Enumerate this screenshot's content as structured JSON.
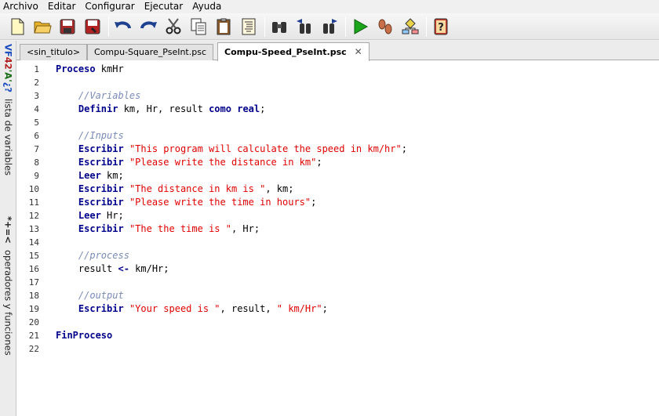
{
  "menu": [
    "Archivo",
    "Editar",
    "Configurar",
    "Ejecutar",
    "Ayuda"
  ],
  "toolbar": {
    "buttons": [
      {
        "name": "new-file-icon"
      },
      {
        "name": "open-folder-icon"
      },
      {
        "name": "save-icon"
      },
      {
        "name": "save-as-icon"
      },
      {
        "name": "undo-icon"
      },
      {
        "name": "redo-icon"
      },
      {
        "name": "cut-icon"
      },
      {
        "name": "copy-icon"
      },
      {
        "name": "paste-icon"
      },
      {
        "name": "indent-icon"
      },
      {
        "name": "find-icon"
      },
      {
        "name": "find-previous-icon"
      },
      {
        "name": "find-next-icon"
      },
      {
        "name": "run-icon"
      },
      {
        "name": "step-by-step-icon"
      },
      {
        "name": "flowchart-icon"
      },
      {
        "name": "help-icon"
      }
    ]
  },
  "side_tabs": {
    "variables": {
      "icon_parts": [
        "V",
        "F",
        "42",
        "'A'",
        "¿?"
      ],
      "label": "lista de variables"
    },
    "operators": {
      "icon": "*+=<",
      "label": "operadores y funciones"
    }
  },
  "tabs": [
    {
      "label": "<sin_titulo>",
      "active": false
    },
    {
      "label": "Compu-Square_PseInt.psc",
      "active": false
    },
    {
      "label": "Compu-Speed_PseInt.psc",
      "active": true,
      "close": "✕"
    }
  ],
  "editor": {
    "lines": [
      {
        "n": "1",
        "tokens": [
          {
            "t": "Proceso",
            "k": "kw"
          },
          {
            "t": " kmHr",
            "k": "plain"
          }
        ]
      },
      {
        "n": "2",
        "tokens": []
      },
      {
        "n": "3",
        "tokens": [
          {
            "t": "    //Variables",
            "k": "cmt"
          }
        ]
      },
      {
        "n": "4",
        "tokens": [
          {
            "t": "    ",
            "k": "plain"
          },
          {
            "t": "Definir",
            "k": "kw"
          },
          {
            "t": " km, Hr, result ",
            "k": "plain"
          },
          {
            "t": "como",
            "k": "kw"
          },
          {
            "t": " ",
            "k": "plain"
          },
          {
            "t": "real",
            "k": "kw"
          },
          {
            "t": ";",
            "k": "plain"
          }
        ]
      },
      {
        "n": "5",
        "tokens": []
      },
      {
        "n": "6",
        "tokens": [
          {
            "t": "    //Inputs",
            "k": "cmt"
          }
        ]
      },
      {
        "n": "7",
        "tokens": [
          {
            "t": "    ",
            "k": "plain"
          },
          {
            "t": "Escribir",
            "k": "kw"
          },
          {
            "t": " ",
            "k": "plain"
          },
          {
            "t": "\"This program will calculate the speed in km/hr\"",
            "k": "str"
          },
          {
            "t": ";",
            "k": "plain"
          }
        ]
      },
      {
        "n": "8",
        "tokens": [
          {
            "t": "    ",
            "k": "plain"
          },
          {
            "t": "Escribir",
            "k": "kw"
          },
          {
            "t": " ",
            "k": "plain"
          },
          {
            "t": "\"Please write the distance in km\"",
            "k": "str"
          },
          {
            "t": ";",
            "k": "plain"
          }
        ]
      },
      {
        "n": "9",
        "tokens": [
          {
            "t": "    ",
            "k": "plain"
          },
          {
            "t": "Leer",
            "k": "kw"
          },
          {
            "t": " km;",
            "k": "plain"
          }
        ]
      },
      {
        "n": "10",
        "tokens": [
          {
            "t": "    ",
            "k": "plain"
          },
          {
            "t": "Escribir",
            "k": "kw"
          },
          {
            "t": " ",
            "k": "plain"
          },
          {
            "t": "\"The distance in km is \"",
            "k": "str"
          },
          {
            "t": ", km;",
            "k": "plain"
          }
        ]
      },
      {
        "n": "11",
        "tokens": [
          {
            "t": "    ",
            "k": "plain"
          },
          {
            "t": "Escribir",
            "k": "kw"
          },
          {
            "t": " ",
            "k": "plain"
          },
          {
            "t": "\"Please write the time in hours\"",
            "k": "str"
          },
          {
            "t": ";",
            "k": "plain"
          }
        ]
      },
      {
        "n": "12",
        "tokens": [
          {
            "t": "    ",
            "k": "plain"
          },
          {
            "t": "Leer",
            "k": "kw"
          },
          {
            "t": " Hr;",
            "k": "plain"
          }
        ]
      },
      {
        "n": "13",
        "tokens": [
          {
            "t": "    ",
            "k": "plain"
          },
          {
            "t": "Escribir",
            "k": "kw"
          },
          {
            "t": " ",
            "k": "plain"
          },
          {
            "t": "\"The the time is \"",
            "k": "str"
          },
          {
            "t": ", Hr;",
            "k": "plain"
          }
        ]
      },
      {
        "n": "14",
        "tokens": []
      },
      {
        "n": "15",
        "tokens": [
          {
            "t": "    //process",
            "k": "cmt"
          }
        ]
      },
      {
        "n": "16",
        "tokens": [
          {
            "t": "    result ",
            "k": "plain"
          },
          {
            "t": "<-",
            "k": "kw"
          },
          {
            "t": " km/Hr;",
            "k": "plain"
          }
        ]
      },
      {
        "n": "17",
        "tokens": []
      },
      {
        "n": "18",
        "tokens": [
          {
            "t": "    //output",
            "k": "cmt"
          }
        ]
      },
      {
        "n": "19",
        "tokens": [
          {
            "t": "    ",
            "k": "plain"
          },
          {
            "t": "Escribir",
            "k": "kw"
          },
          {
            "t": " ",
            "k": "plain"
          },
          {
            "t": "\"Your speed is \"",
            "k": "str"
          },
          {
            "t": ", result, ",
            "k": "plain"
          },
          {
            "t": "\" km/Hr\"",
            "k": "str"
          },
          {
            "t": ";",
            "k": "plain"
          }
        ]
      },
      {
        "n": "20",
        "tokens": []
      },
      {
        "n": "21",
        "tokens": [
          {
            "t": "FinProceso",
            "k": "kw"
          }
        ]
      },
      {
        "n": "22",
        "tokens": []
      }
    ]
  }
}
